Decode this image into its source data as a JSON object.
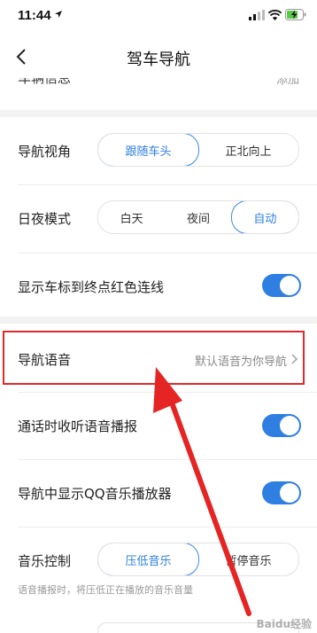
{
  "status_bar": {
    "time": "11:44"
  },
  "nav": {
    "title": "驾车导航"
  },
  "peek": {
    "left": "车辆信息",
    "right": "添加"
  },
  "settings": {
    "view_angle": {
      "label": "导航视角",
      "options": [
        "跟随车头",
        "正北向上"
      ],
      "selected": "跟随车头"
    },
    "day_night": {
      "label": "日夜模式",
      "options": [
        "白天",
        "夜间",
        "自动"
      ],
      "selected": "自动"
    },
    "red_line": {
      "label": "显示车标到终点红色连线",
      "on": true
    },
    "voice": {
      "label": "导航语音",
      "value": "默认语音为你导航"
    },
    "call_voice": {
      "label": "通话时收听语音播报",
      "on": true
    },
    "qq_music": {
      "label": "导航中显示QQ音乐播放器",
      "on": true
    },
    "music_control": {
      "label": "音乐控制",
      "options": [
        "压低音乐",
        "暂停音乐"
      ],
      "selected": "压低音乐",
      "hint": "语音播报时，将压低正在播放的音乐音量"
    }
  },
  "watermark": "Baidu经验",
  "colors": {
    "accent": "#2f7fe3",
    "highlight": "#e02a2a"
  }
}
